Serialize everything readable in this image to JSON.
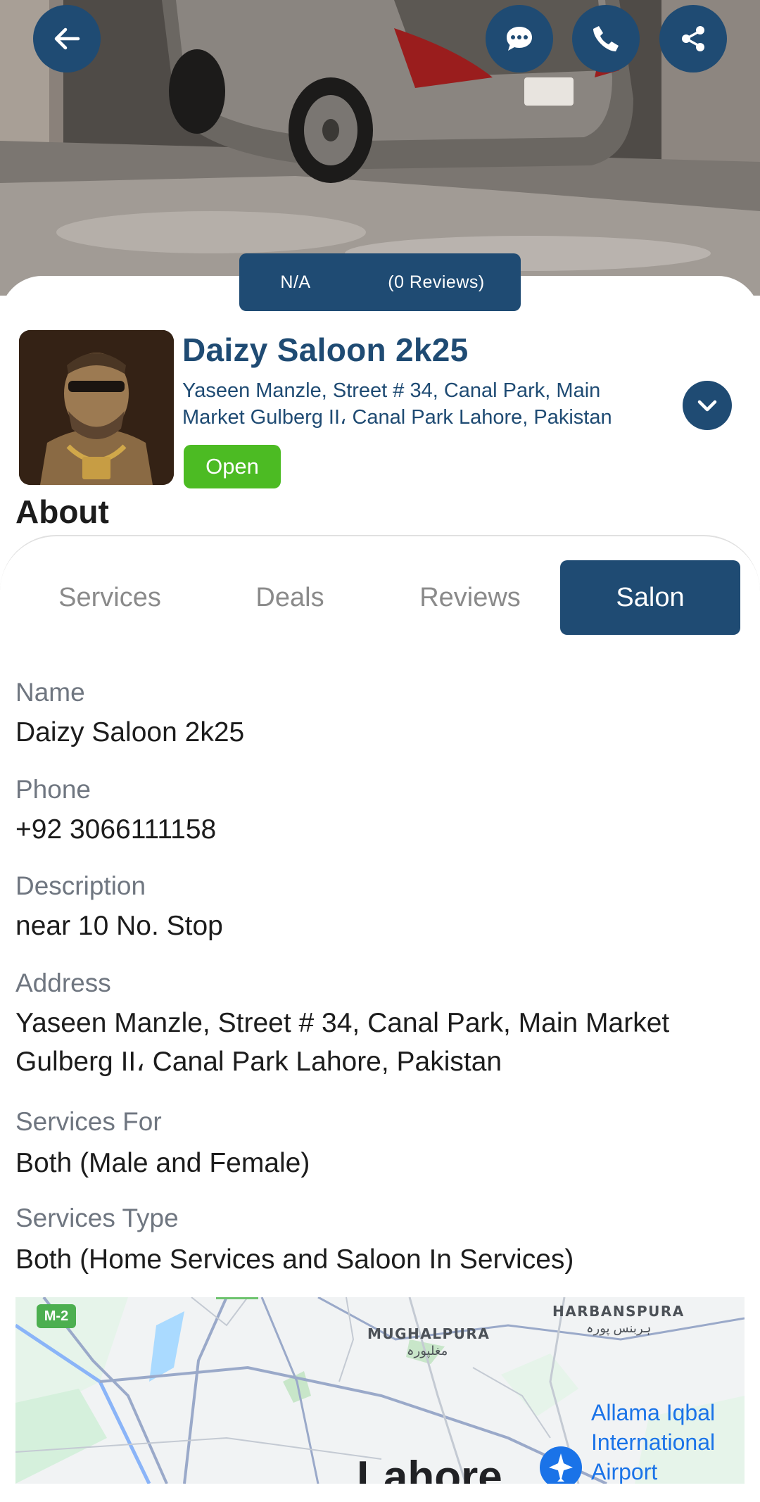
{
  "header": {
    "back_icon": "arrow-left-icon",
    "actions": [
      {
        "name": "chat",
        "icon": "chat-bubble-icon"
      },
      {
        "name": "call",
        "icon": "phone-icon"
      },
      {
        "name": "share",
        "icon": "share-icon"
      }
    ]
  },
  "rating": {
    "value": "N/A",
    "reviews": "(0 Reviews)"
  },
  "salon": {
    "title": "Daizy Saloon 2k25",
    "address": "Yaseen Manzle, Street # 34, Canal Park, Main Market Gulberg II، Canal Park Lahore, Pakistan",
    "status": "Open",
    "expand_icon": "chevron-down-icon"
  },
  "about": {
    "heading": "About"
  },
  "tabs": [
    {
      "label": "Services",
      "active": false
    },
    {
      "label": "Deals",
      "active": false
    },
    {
      "label": "Reviews",
      "active": false
    },
    {
      "label": "Salon",
      "active": true
    }
  ],
  "details": [
    {
      "label": "Name",
      "value": "Daizy Saloon 2k25"
    },
    {
      "label": "Phone",
      "value": "+92 3066111158"
    },
    {
      "label": "Description",
      "value": "near 10 No. Stop"
    },
    {
      "label": "Address",
      "value": "Yaseen Manzle, Street # 34, Canal Park, Main Market Gulberg II، Canal Park Lahore, Pakistan"
    },
    {
      "label": "Services For",
      "value": "Both (Male and Female)"
    },
    {
      "label": "Services Type",
      "value": "Both (Home Services and Saloon In Services)"
    }
  ],
  "map": {
    "highway": "M-2",
    "areas": [
      {
        "name": "MUGHALPURA",
        "local": "مغلپورہ"
      },
      {
        "name": "HARBANSPURA",
        "local": "ہربنس پورہ"
      }
    ],
    "airport": "Allama Iqbal International Airport",
    "city": "Lahore"
  },
  "colors": {
    "primary": "#1f4b73",
    "open_badge": "#4cbb23",
    "label_gray": "#6f7680",
    "map_link": "#1a73e8"
  }
}
